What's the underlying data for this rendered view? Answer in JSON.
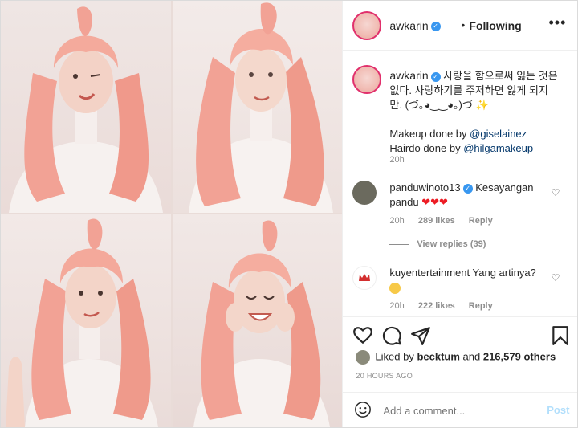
{
  "header": {
    "username": "awkarin",
    "separator": "•",
    "follow_status": "Following",
    "more": "•••"
  },
  "caption": {
    "username": "awkarin",
    "text_lines": [
      "사랑을 함으로써 잃는 것은",
      "없다. 사랑하기를 주저하면 잃게 되지",
      "만. (づ｡◕‿‿◕｡)づ ✨"
    ],
    "credit_makeup_prefix": "Makeup done by ",
    "credit_makeup_handle": "@giselainez",
    "credit_hair_prefix": "Hairdo done by ",
    "credit_hair_handle": "@hilgamakeup",
    "time": "20h"
  },
  "comments": [
    {
      "username": "panduwinoto13",
      "verified": true,
      "text": "Kesayangan pandu",
      "hearts": "❤❤❤",
      "time": "20h",
      "likes": "289 likes",
      "reply": "Reply",
      "view_replies": "View replies (39)"
    },
    {
      "username": "kuyentertainment",
      "verified": false,
      "text": "Yang artinya?",
      "time": "20h",
      "likes": "222 likes",
      "reply": "Reply"
    }
  ],
  "likes": {
    "prefix": "Liked by ",
    "user": "becktum",
    "middle": " and ",
    "count": "216,579 others"
  },
  "post_time": "20 HOURS AGO",
  "add_comment": {
    "placeholder": "Add a comment...",
    "post_label": "Post"
  },
  "colors": {
    "verified": "#3897f0",
    "hair": "#f2a295",
    "link": "#003569",
    "post_button": "#b2dffc"
  },
  "icons": [
    "heart-icon",
    "comment-icon",
    "share-icon",
    "bookmark-icon",
    "smile-icon",
    "verified-icon",
    "more-icon"
  ]
}
